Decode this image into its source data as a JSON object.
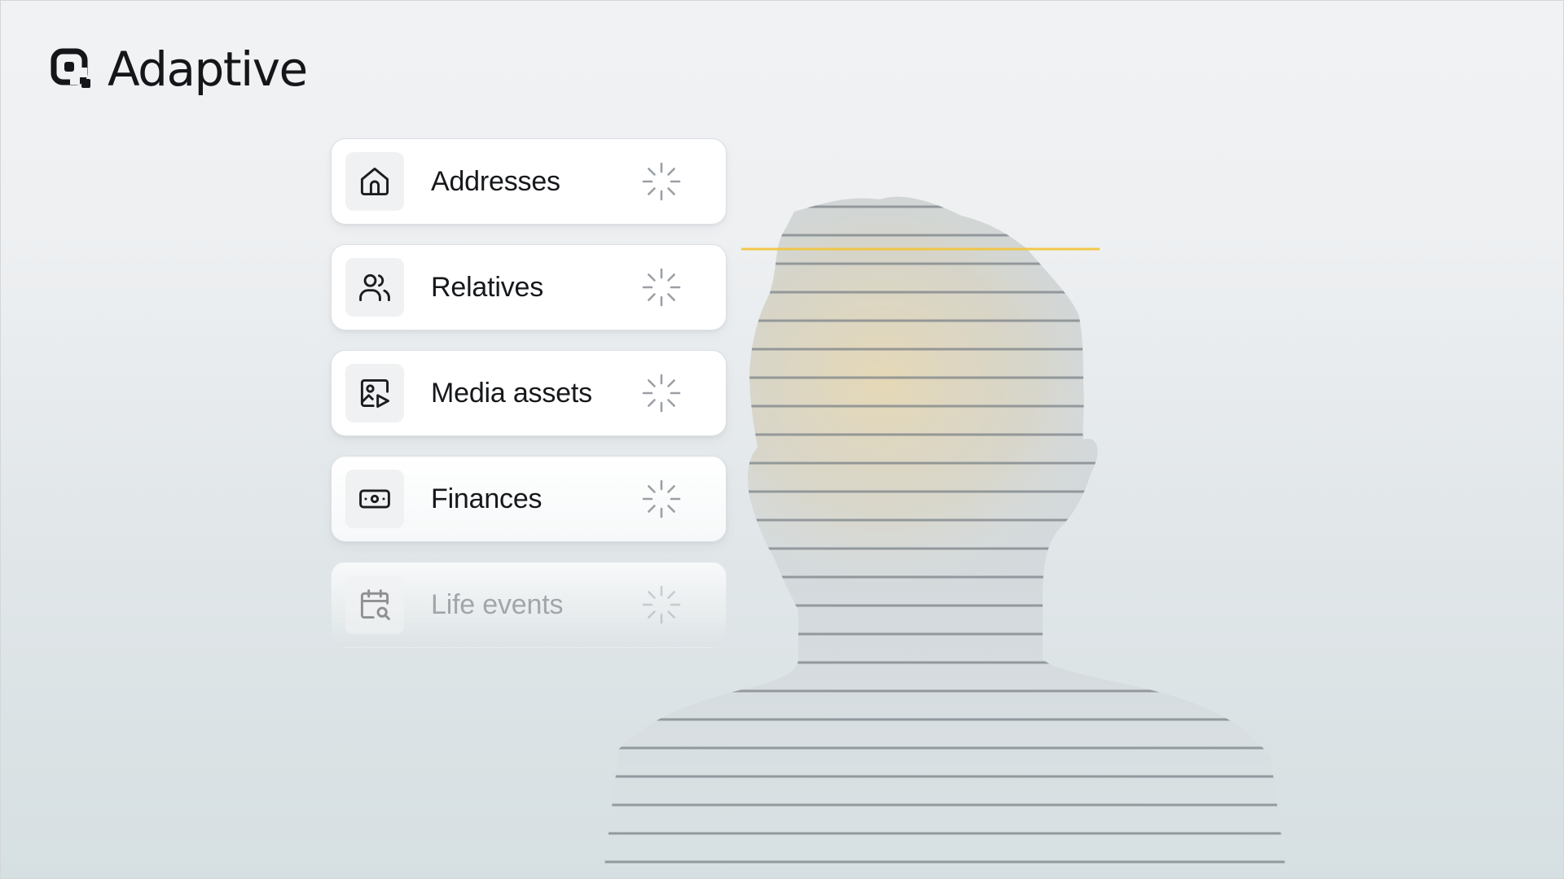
{
  "brand": {
    "name": "Adaptive",
    "logo_icon": "adaptive-logo-icon"
  },
  "cards": [
    {
      "label": "Addresses",
      "icon": "home-icon",
      "status": "loading"
    },
    {
      "label": "Relatives",
      "icon": "users-icon",
      "status": "loading"
    },
    {
      "label": "Media assets",
      "icon": "image-play-icon",
      "status": "loading"
    },
    {
      "label": "Finances",
      "icon": "banknote-icon",
      "status": "loading"
    },
    {
      "label": "Life events",
      "icon": "calendar-search-icon",
      "status": "loading"
    }
  ],
  "illustration": {
    "subject": "person-silhouette",
    "scan_line_color": "#f3c53a"
  },
  "colors": {
    "text": "#16181b",
    "card_bg": "#ffffff",
    "icon_bg": "#f0f1f2",
    "accent": "#f3c53a"
  }
}
